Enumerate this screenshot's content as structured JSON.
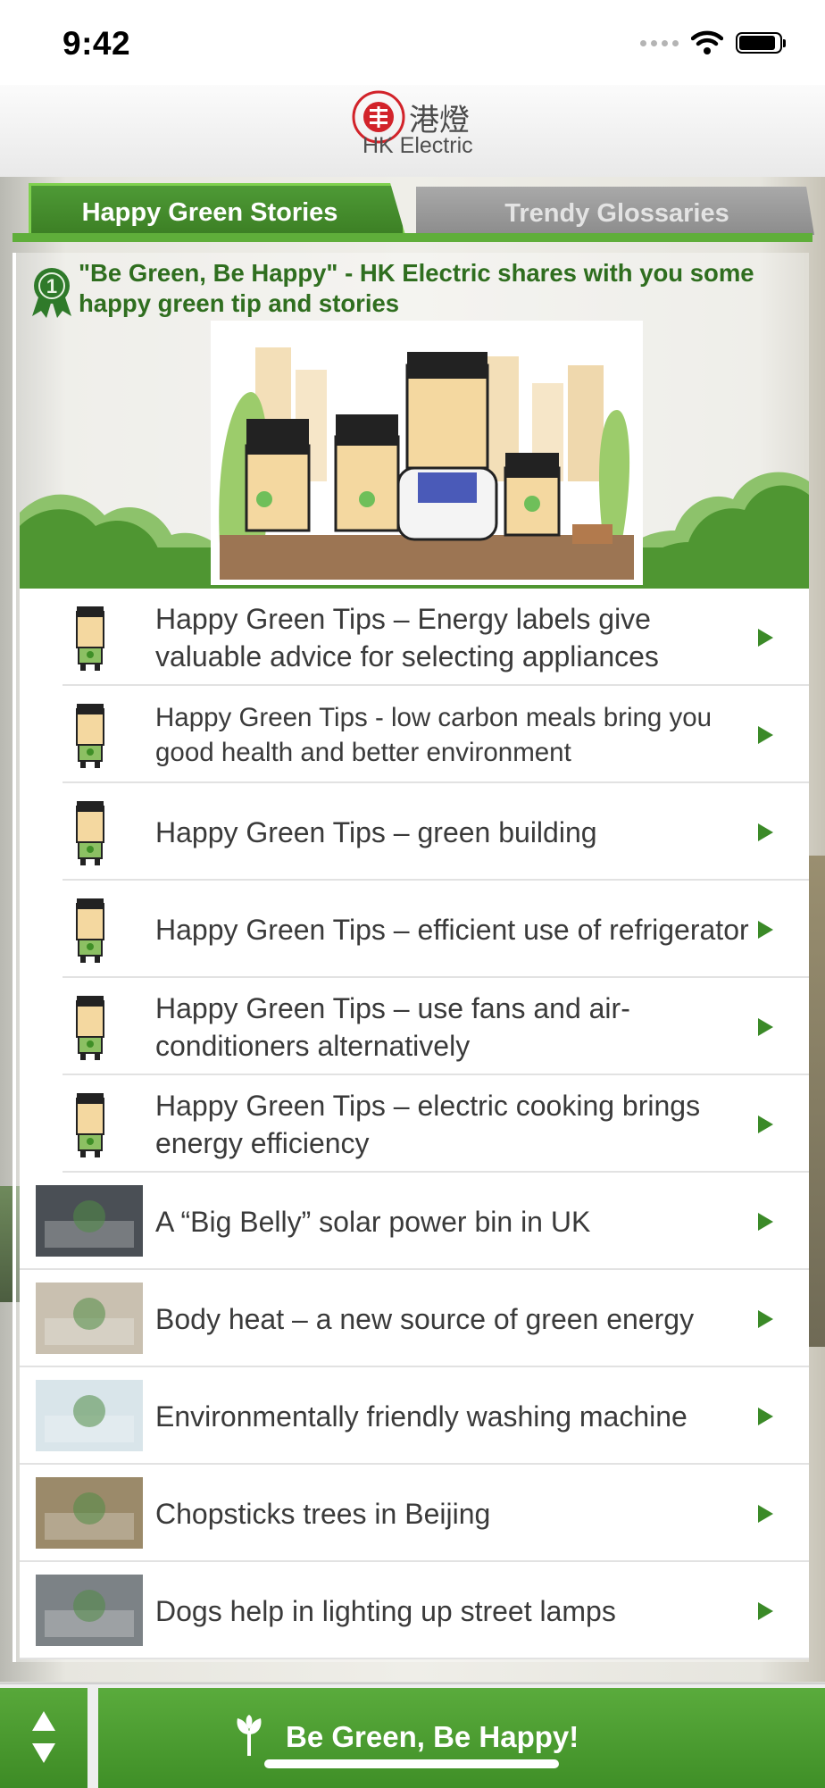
{
  "status_bar": {
    "time": "9:42"
  },
  "header": {
    "logo_chinese": "港燈",
    "logo_english": "HK Electric",
    "logo_ring_text": "hongkong electric"
  },
  "tabs": [
    {
      "label": "Happy Green Stories",
      "selected": true
    },
    {
      "label": "Trendy Glossaries",
      "selected": false
    }
  ],
  "intro": {
    "badge_number": "1",
    "text": "\"Be Green, Be Happy\" - HK Electric shares with you some happy green tip and stories"
  },
  "list": [
    {
      "title": "Happy Green Tips – Energy labels give valuable advice for selecting appliances",
      "thumb": "character",
      "style": "normal"
    },
    {
      "title": "Happy Green Tips -  low carbon meals bring you good health and better environment",
      "thumb": "character",
      "style": "small"
    },
    {
      "title": "Happy Green Tips – green building",
      "thumb": "character",
      "style": "normal"
    },
    {
      "title": "Happy Green Tips – efficient use of refrigerator",
      "thumb": "character",
      "style": "normal"
    },
    {
      "title": "Happy Green Tips – use fans and air-conditioners alternatively",
      "thumb": "character",
      "style": "normal"
    },
    {
      "title": "Happy Green Tips – electric cooking brings energy efficiency",
      "thumb": "character",
      "style": "normal"
    },
    {
      "title": "A “Big Belly” solar power bin in UK",
      "thumb": "photo",
      "style": "normal"
    },
    {
      "title": "Body heat – a new source of green energy",
      "thumb": "photo",
      "style": "normal"
    },
    {
      "title": "Environmentally friendly washing machine",
      "thumb": "photo",
      "style": "normal"
    },
    {
      "title": "Chopsticks trees in Beijing",
      "thumb": "photo",
      "style": "normal"
    },
    {
      "title": "Dogs help in lighting up street lamps",
      "thumb": "photo",
      "style": "normal"
    }
  ],
  "bottom_bar": {
    "label": "Be Green, Be Happy!"
  },
  "colors": {
    "brand_green": "#3f8f27",
    "title_green": "#2f6e1f",
    "logo_red": "#d2232a"
  }
}
